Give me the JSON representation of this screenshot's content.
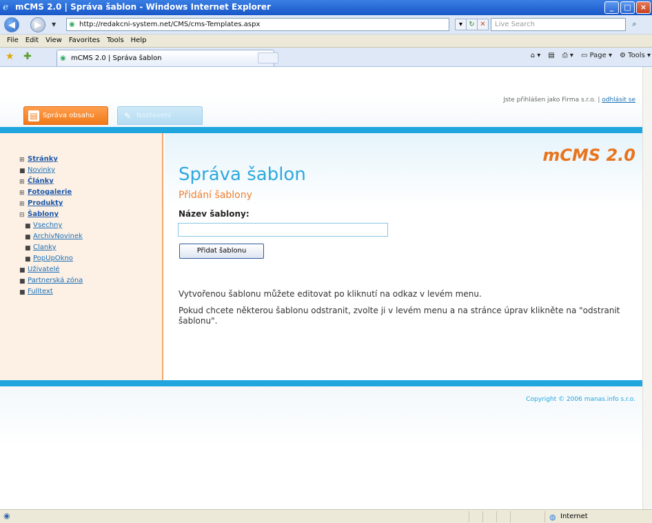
{
  "window": {
    "title": "mCMS 2.0 | Správa šablon - Windows Internet Explorer",
    "min": "_",
    "max": "□",
    "close": "×"
  },
  "browser": {
    "url": "http://redakcni-system.net/CMS/cms-Templates.aspx",
    "search_placeholder": "Live Search",
    "menu": [
      "File",
      "Edit",
      "View",
      "Favorites",
      "Tools",
      "Help"
    ],
    "tab_title": "mCMS 2.0 | Správa šablon",
    "commands": [
      "Page",
      "Tools"
    ],
    "status_zone": "Internet"
  },
  "page": {
    "login_text": "Jste přihlášen jako Firma s.r.o. |",
    "logout_link": "odhlásit se",
    "tabs": [
      "Správa obsahu",
      "Nastavení"
    ],
    "brand": "mCMS 2.0",
    "title": "Správa šablon",
    "subtitle": "Přidání šablony",
    "field_label": "Název šablony:",
    "field_value": "",
    "button_label": "Přidat šablonu",
    "info1": "Vytvořenou šablonu můžete editovat po kliknutí na odkaz v levém menu.",
    "info2": "Pokud chcete některou šablonu odstranit, zvolte ji v levém menu a na stránce úprav klikněte na \"odstranit šablonu\".",
    "copyright": "Copyright © 2006 manas.info s.r.o."
  },
  "menu": {
    "items": [
      {
        "label": "Stránky",
        "bullet": "⊞",
        "bold": true
      },
      {
        "label": "Novinky",
        "bullet": "■",
        "bold": false
      },
      {
        "label": "Články",
        "bullet": "⊞",
        "bold": true
      },
      {
        "label": "Fotogalerie",
        "bullet": "⊞",
        "bold": true
      },
      {
        "label": "Produkty",
        "bullet": "⊞",
        "bold": true
      },
      {
        "label": "Šablony",
        "bullet": "⊟",
        "bold": true
      }
    ],
    "subitems": [
      "Vsechny",
      "ArchivNovinek",
      "Clanky",
      "PopUpOkno"
    ],
    "items2": [
      {
        "label": "Uživatelé",
        "bullet": "■"
      },
      {
        "label": "Partnerská zóna",
        "bullet": "■"
      },
      {
        "label": "Fulltext",
        "bullet": "■"
      }
    ]
  },
  "colors": {
    "accent_orange": "#ef7e2a",
    "accent_blue": "#1fa6df"
  }
}
